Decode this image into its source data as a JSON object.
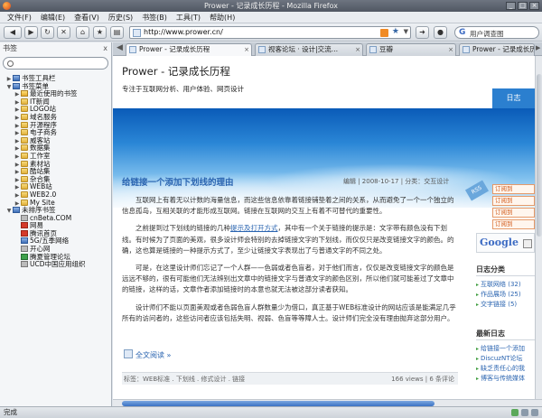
{
  "window": {
    "title": "Prower - 记录成长历程 - Mozilla Firefox"
  },
  "menu": [
    "文件(F)",
    "编辑(E)",
    "查看(V)",
    "历史(S)",
    "书签(B)",
    "工具(T)",
    "帮助(H)"
  ],
  "toolbar": {
    "back_icon": "◀",
    "forward_icon": "▶",
    "reload_icon": "↻",
    "stop_icon": "✕",
    "home_icon": "⌂",
    "url": "http://www.prower.cn/",
    "search_engine": "G",
    "search_placeholder": "用户调查图"
  },
  "sidebar": {
    "title": "书签",
    "close": "x",
    "items": [
      {
        "label": "书签工具栏",
        "icon": "blue",
        "indent": 0,
        "arrow": "▶"
      },
      {
        "label": "书签菜单",
        "icon": "blue",
        "indent": 0,
        "arrow": "▼"
      },
      {
        "label": "最近使用的书签",
        "icon": "starf",
        "indent": 1,
        "arrow": "▶"
      },
      {
        "label": "IT新闻",
        "icon": "fold",
        "indent": 1,
        "arrow": "▶"
      },
      {
        "label": "LOGO站",
        "icon": "fold",
        "indent": 1,
        "arrow": "▶"
      },
      {
        "label": "域名服务",
        "icon": "fold",
        "indent": 1,
        "arrow": "▶"
      },
      {
        "label": "开源程序",
        "icon": "fold",
        "indent": 1,
        "arrow": "▶"
      },
      {
        "label": "电子商务",
        "icon": "fold",
        "indent": 1,
        "arrow": "▶"
      },
      {
        "label": "威客站",
        "icon": "fold",
        "indent": 1,
        "arrow": "▶"
      },
      {
        "label": "数据集",
        "icon": "fold",
        "indent": 1,
        "arrow": "▶"
      },
      {
        "label": "工作室",
        "icon": "fold",
        "indent": 1,
        "arrow": "▶"
      },
      {
        "label": "素材站",
        "icon": "fold",
        "indent": 1,
        "arrow": "▶"
      },
      {
        "label": "酷站集",
        "icon": "fold",
        "indent": 1,
        "arrow": "▶"
      },
      {
        "label": "杂合集",
        "icon": "fold",
        "indent": 1,
        "arrow": "▶"
      },
      {
        "label": "WEB站",
        "icon": "fold",
        "indent": 1,
        "arrow": "▶"
      },
      {
        "label": "WEB2.0",
        "icon": "fold",
        "indent": 1,
        "arrow": "▶"
      },
      {
        "label": "My Site",
        "icon": "fold",
        "indent": 1,
        "arrow": "▶"
      },
      {
        "label": "未排序书签",
        "icon": "blue",
        "indent": 0,
        "arrow": "▼"
      },
      {
        "label": "cnBeta.COM",
        "icon": "gry",
        "indent": 1,
        "arrow": ""
      },
      {
        "label": "网易",
        "icon": "red",
        "indent": 1,
        "arrow": ""
      },
      {
        "label": "腾讯首页",
        "icon": "red",
        "indent": 1,
        "arrow": ""
      },
      {
        "label": "5G/五季网络",
        "icon": "blue",
        "indent": 1,
        "arrow": ""
      },
      {
        "label": "开心网",
        "icon": "gry",
        "indent": 1,
        "arrow": ""
      },
      {
        "label": "腾夏管理论坛",
        "icon": "grn",
        "indent": 1,
        "arrow": ""
      },
      {
        "label": "UCD中国应用组织",
        "icon": "gry",
        "indent": 1,
        "arrow": ""
      }
    ]
  },
  "tabs": [
    {
      "label": "Prower - 记录成长历程",
      "active": true
    },
    {
      "label": "视客论坛 · 设计|交流…",
      "active": false
    },
    {
      "label": "豆瓣",
      "active": false
    },
    {
      "label": "Prower - 记录成长历程",
      "active": false
    }
  ],
  "page": {
    "site_title": "Prower - 记录成长历程",
    "site_sub": "专注于互联网分析、用户体验、网页设计",
    "nav": "日志",
    "post": {
      "title": "给链接一个添加下划线的理由",
      "meta": "编辑  |  2008-10-17  |  分类：交互设计",
      "p1": "互联网上有着无以计数的海量信息，而这些信息依靠着链接铺垫着之间的关系，从而避免了一个一个独立的信息孤岛，互相关联的才能形成互联网。链接在互联网的交互上有着不可替代的重要性。",
      "p2_a": "之前提到过下划线的链接的几种",
      "p2_link": "提示及打开方式",
      "p2_b": "，其中有一个关于链接的提示是：文字带有颜色没有下划线。有时候为了页面的美观，很多设计师会特别的去掉链接文字的下划线，而仅仅只是改变链接文字的颜色。的确，这也算是链接的一种提示方式了，至少让链接文字表现出了与普通文字的不同之处。",
      "p3": "可是，在这里设计师们忘记了一个人群——色弱或者色盲者，对于他们而言，仅仅是改变链接文字的颜色是远远不够的，很有可能他们无法辨别出文章中的链接文字与普通文字的颜色区别，所以他们就可能差过了文章中的链接，这样的话，文章作者添加链接时的本意也就无法被这部分读者获知。",
      "p4": "设计师们不能以页面美观或者色弱色盲人群数量少为借口，真正基于WEB标准设计的网站应该是能满足几乎所有的访问者的，这些访问者应该包括失明、视弱、色盲等等障人士。设计师们完全没有理由抛弃这部分用户。",
      "more": "全文阅读 »",
      "tags": "标签：WEB标准 . 下划线 . 修式设计 . 链接",
      "stats": "166 views  |  6 条评论"
    },
    "right": {
      "rss": "RSS",
      "subs": [
        "订阅到",
        "订阅到",
        "订阅到",
        "订阅到"
      ],
      "google": "Google",
      "cat_title": "日志分类",
      "cats": [
        "互联网络 (32)",
        "作品展场 (25)",
        "交字链接 (5)"
      ],
      "recent_title": "最新日志",
      "recent": [
        "给链接一个添加",
        "DiscuzNT论坛",
        "缺乏责任心的我",
        "博客与传统媒体"
      ]
    }
  },
  "status": {
    "text": "完成"
  }
}
